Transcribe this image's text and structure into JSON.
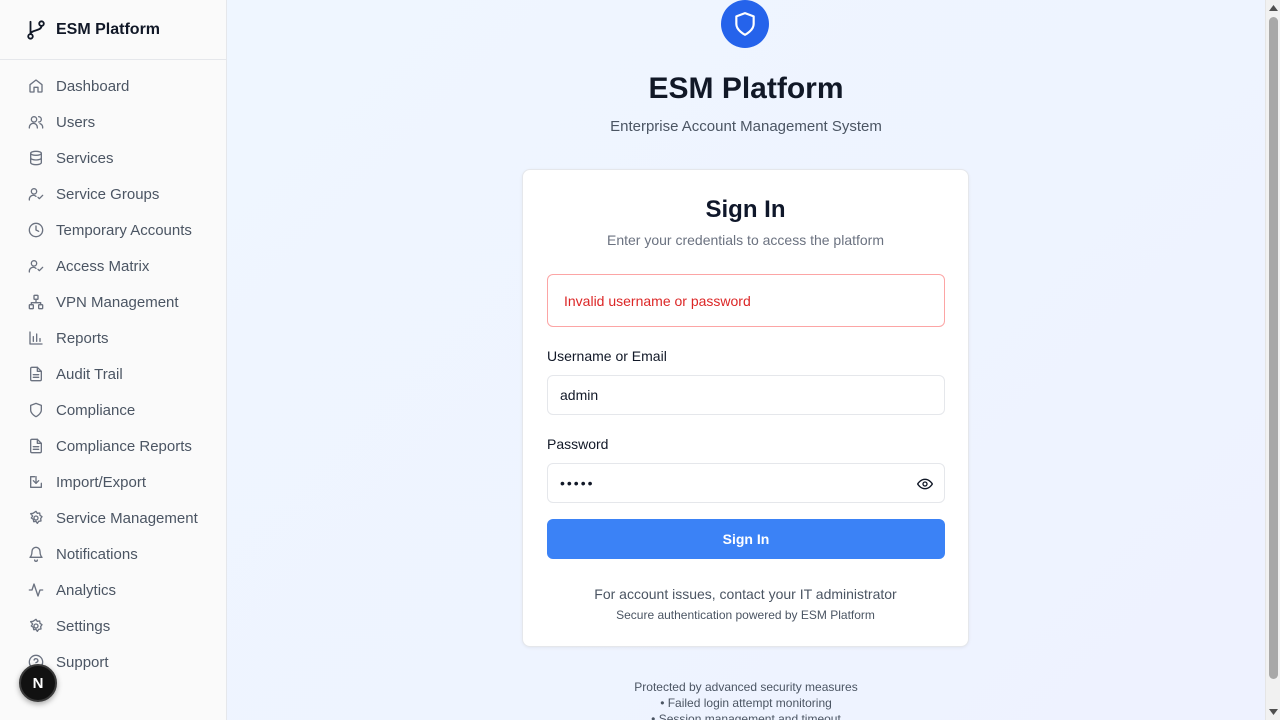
{
  "sidebar": {
    "brand": "ESM Platform",
    "items": [
      {
        "label": "Dashboard",
        "icon": "home-icon"
      },
      {
        "label": "Users",
        "icon": "users-icon"
      },
      {
        "label": "Services",
        "icon": "database-icon"
      },
      {
        "label": "Service Groups",
        "icon": "user-check-icon"
      },
      {
        "label": "Temporary Accounts",
        "icon": "clock-icon"
      },
      {
        "label": "Access Matrix",
        "icon": "user-check-icon"
      },
      {
        "label": "VPN Management",
        "icon": "network-icon"
      },
      {
        "label": "Reports",
        "icon": "bar-chart-icon"
      },
      {
        "label": "Audit Trail",
        "icon": "file-text-icon"
      },
      {
        "label": "Compliance",
        "icon": "shield-icon"
      },
      {
        "label": "Compliance Reports",
        "icon": "file-text-icon"
      },
      {
        "label": "Import/Export",
        "icon": "import-icon"
      },
      {
        "label": "Service Management",
        "icon": "gear-icon"
      },
      {
        "label": "Notifications",
        "icon": "bell-icon"
      },
      {
        "label": "Analytics",
        "icon": "activity-icon"
      },
      {
        "label": "Settings",
        "icon": "gear-icon"
      },
      {
        "label": "Support",
        "icon": "help-icon"
      }
    ],
    "fab_letter": "N"
  },
  "header": {
    "title": "ESM Platform",
    "subtitle": "Enterprise Account Management System"
  },
  "login": {
    "title": "Sign In",
    "subtitle": "Enter your credentials to access the platform",
    "error": "Invalid username or password",
    "username_label": "Username or Email",
    "username_value": "admin",
    "password_label": "Password",
    "password_value": "•••••",
    "submit_label": "Sign In",
    "footer_line1": "For account issues, contact your IT administrator",
    "footer_line2": "Secure authentication powered by ESM Platform"
  },
  "security": {
    "heading": "Protected by advanced security measures",
    "lines": [
      "• Failed login attempt monitoring",
      "• Session management and timeout"
    ]
  },
  "colors": {
    "primary": "#3b82f6",
    "shield": "#2563eb",
    "error": "#dc2626"
  }
}
